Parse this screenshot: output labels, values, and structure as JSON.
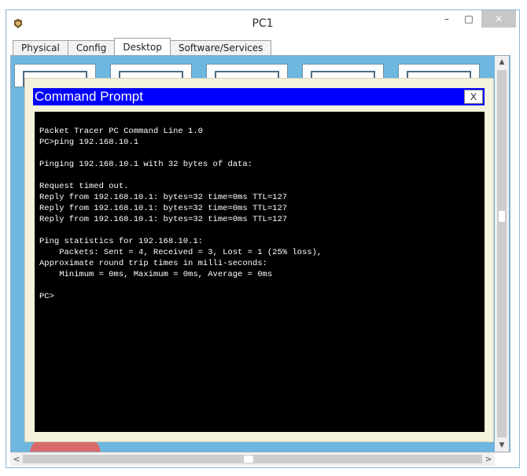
{
  "window": {
    "title": "PC1",
    "minimize_label": "–",
    "maximize_label": "□",
    "close_label": "✕",
    "icon": "packet-tracer-pc-icon"
  },
  "tabs": [
    {
      "label": "Physical",
      "active": false
    },
    {
      "label": "Config",
      "active": false
    },
    {
      "label": "Desktop",
      "active": true
    },
    {
      "label": "Software/Services",
      "active": false
    }
  ],
  "command_prompt": {
    "title": "Command Prompt",
    "close_label": "X",
    "lines": [
      "Packet Tracer PC Command Line 1.0",
      "PC>ping 192.168.10.1",
      "",
      "Pinging 192.168.10.1 with 32 bytes of data:",
      "",
      "Request timed out.",
      "Reply from 192.168.10.1: bytes=32 time=0ms TTL=127",
      "Reply from 192.168.10.1: bytes=32 time=0ms TTL=127",
      "Reply from 192.168.10.1: bytes=32 time=0ms TTL=127",
      "",
      "Ping statistics for 192.168.10.1:",
      "    Packets: Sent = 4, Received = 3, Lost = 1 (25% loss),",
      "Approximate round trip times in milli-seconds:",
      "    Minimum = 0ms, Maximum = 0ms, Average = 0ms",
      "",
      "PC>"
    ]
  },
  "scrollbars": {
    "up_arrow": "▲",
    "down_arrow": "▼",
    "left_arrow": "<",
    "right_arrow": ">"
  },
  "colors": {
    "title_bar": "#0000ff",
    "console_bg": "#000000",
    "console_text": "#ffffff",
    "desktop_bg": "#6db7e0"
  }
}
